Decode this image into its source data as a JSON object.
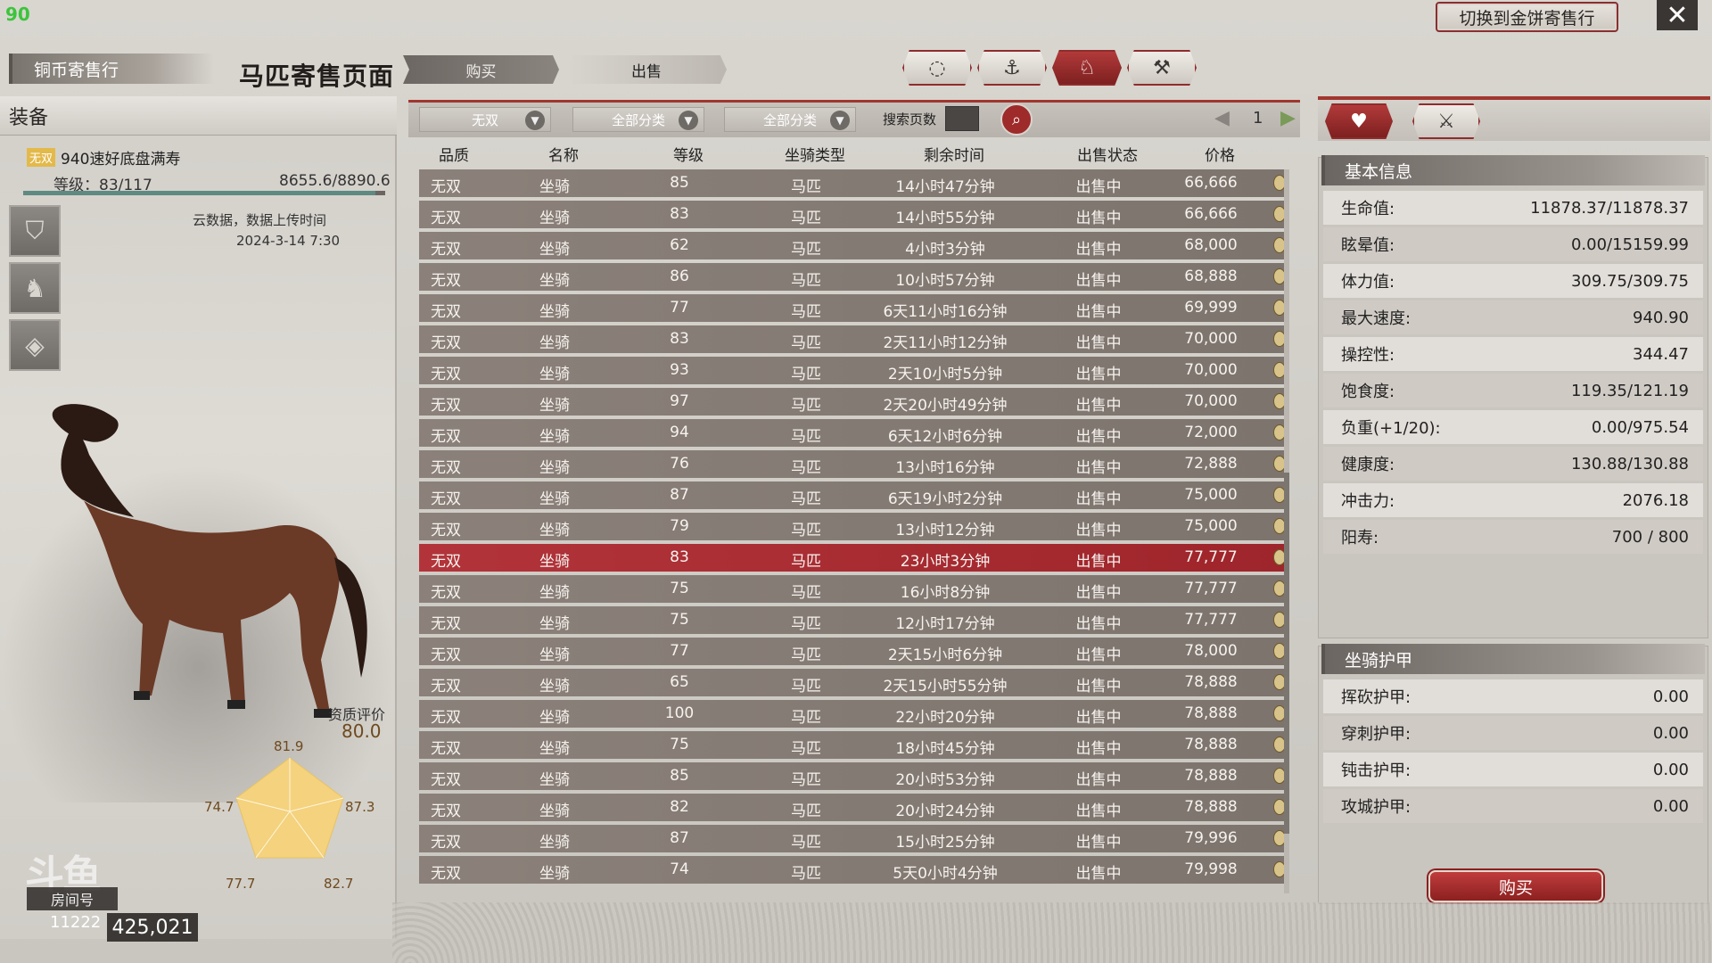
{
  "overlay": {
    "fps": "90"
  },
  "header": {
    "switch_label": "切换到金饼寄售行",
    "close_glyph": "✕",
    "copper_tab": "铜币寄售行",
    "page_title": "马匹寄售页面",
    "buy_tab": "购买",
    "sell_tab": "出售",
    "category_icons": [
      "saddle-icon",
      "stirrup-icon",
      "horse-head-icon",
      "hammer-icon"
    ],
    "active_category": 2
  },
  "equipment": {
    "title": "装备",
    "quality_badge": "无双",
    "horse_name": "940速好底盘满寿",
    "level_text": "等级：83/117",
    "exp_text": "8655.6/8890.6",
    "exp_fraction": 0.974,
    "upload_note": "云数据，数据上传时间",
    "upload_time": "2024-3-14 7:30",
    "slots": [
      "saddle-slot-icon",
      "armor-slot-icon",
      "horseshoe-slot-icon"
    ],
    "aptitude_label": "资质评价",
    "aptitude_value": "80.0",
    "radar": {
      "top": "81.9",
      "right": "87.3",
      "bottom_right": "82.7",
      "bottom_left": "77.7",
      "left": "74.7"
    }
  },
  "stream_overlay": {
    "logo": "斗鱼",
    "room_tag": "房间号",
    "room_no": "11222",
    "coins": "425,021"
  },
  "filters": {
    "quality": "无双",
    "category1": "全部分类",
    "category2": "全部分类",
    "search_label": "搜索页数",
    "page": "1"
  },
  "table": {
    "columns": [
      "品质",
      "名称",
      "等级",
      "坐骑类型",
      "剩余时间",
      "出售状态",
      "价格"
    ],
    "selected_index": 12,
    "rows": [
      [
        "无双",
        "坐骑",
        "85",
        "马匹",
        "14小时47分钟",
        "出售中",
        "66,666"
      ],
      [
        "无双",
        "坐骑",
        "83",
        "马匹",
        "14小时55分钟",
        "出售中",
        "66,666"
      ],
      [
        "无双",
        "坐骑",
        "62",
        "马匹",
        "4小时3分钟",
        "出售中",
        "68,000"
      ],
      [
        "无双",
        "坐骑",
        "86",
        "马匹",
        "10小时57分钟",
        "出售中",
        "68,888"
      ],
      [
        "无双",
        "坐骑",
        "77",
        "马匹",
        "6天11小时16分钟",
        "出售中",
        "69,999"
      ],
      [
        "无双",
        "坐骑",
        "83",
        "马匹",
        "2天11小时12分钟",
        "出售中",
        "70,000"
      ],
      [
        "无双",
        "坐骑",
        "93",
        "马匹",
        "2天10小时5分钟",
        "出售中",
        "70,000"
      ],
      [
        "无双",
        "坐骑",
        "97",
        "马匹",
        "2天20小时49分钟",
        "出售中",
        "70,000"
      ],
      [
        "无双",
        "坐骑",
        "94",
        "马匹",
        "6天12小时6分钟",
        "出售中",
        "72,000"
      ],
      [
        "无双",
        "坐骑",
        "76",
        "马匹",
        "13小时16分钟",
        "出售中",
        "72,888"
      ],
      [
        "无双",
        "坐骑",
        "87",
        "马匹",
        "6天19小时2分钟",
        "出售中",
        "75,000"
      ],
      [
        "无双",
        "坐骑",
        "79",
        "马匹",
        "13小时12分钟",
        "出售中",
        "75,000"
      ],
      [
        "无双",
        "坐骑",
        "83",
        "马匹",
        "23小时3分钟",
        "出售中",
        "77,777"
      ],
      [
        "无双",
        "坐骑",
        "75",
        "马匹",
        "16小时8分钟",
        "出售中",
        "77,777"
      ],
      [
        "无双",
        "坐骑",
        "75",
        "马匹",
        "12小时17分钟",
        "出售中",
        "77,777"
      ],
      [
        "无双",
        "坐骑",
        "77",
        "马匹",
        "2天15小时6分钟",
        "出售中",
        "78,000"
      ],
      [
        "无双",
        "坐骑",
        "65",
        "马匹",
        "2天15小时55分钟",
        "出售中",
        "78,888"
      ],
      [
        "无双",
        "坐骑",
        "100",
        "马匹",
        "22小时20分钟",
        "出售中",
        "78,888"
      ],
      [
        "无双",
        "坐骑",
        "75",
        "马匹",
        "18小时45分钟",
        "出售中",
        "78,888"
      ],
      [
        "无双",
        "坐骑",
        "85",
        "马匹",
        "20小时53分钟",
        "出售中",
        "78,888"
      ],
      [
        "无双",
        "坐骑",
        "82",
        "马匹",
        "20小时24分钟",
        "出售中",
        "78,888"
      ],
      [
        "无双",
        "坐骑",
        "87",
        "马匹",
        "15小时25分钟",
        "出售中",
        "79,996"
      ],
      [
        "无双",
        "坐骑",
        "74",
        "马匹",
        "5天0小时4分钟",
        "出售中",
        "79,998"
      ]
    ]
  },
  "right_panel": {
    "tab_icons": [
      "heart-icon",
      "horse-armor-icon"
    ],
    "basic_title": "基本信息",
    "basic_stats": [
      {
        "label": "生命值:",
        "value": "11878.37/11878.37"
      },
      {
        "label": "眩晕值:",
        "value": "0.00/15159.99"
      },
      {
        "label": "体力值:",
        "value": "309.75/309.75"
      },
      {
        "label": "最大速度:",
        "value": "940.90"
      },
      {
        "label": "操控性:",
        "value": "344.47"
      },
      {
        "label": "饱食度:",
        "value": "119.35/121.19"
      },
      {
        "label": "负重(+1/20):",
        "value": "0.00/975.54"
      },
      {
        "label": "健康度:",
        "value": "130.88/130.88"
      },
      {
        "label": "冲击力:",
        "value": "2076.18"
      },
      {
        "label": "阳寿:",
        "value": "700 / 800"
      }
    ],
    "armor_title": "坐骑护甲",
    "armor_stats": [
      {
        "label": "挥砍护甲:",
        "value": "0.00"
      },
      {
        "label": "穿刺护甲:",
        "value": "0.00"
      },
      {
        "label": "钝击护甲:",
        "value": "0.00"
      },
      {
        "label": "攻城护甲:",
        "value": "0.00"
      }
    ],
    "buy_label": "购买"
  }
}
